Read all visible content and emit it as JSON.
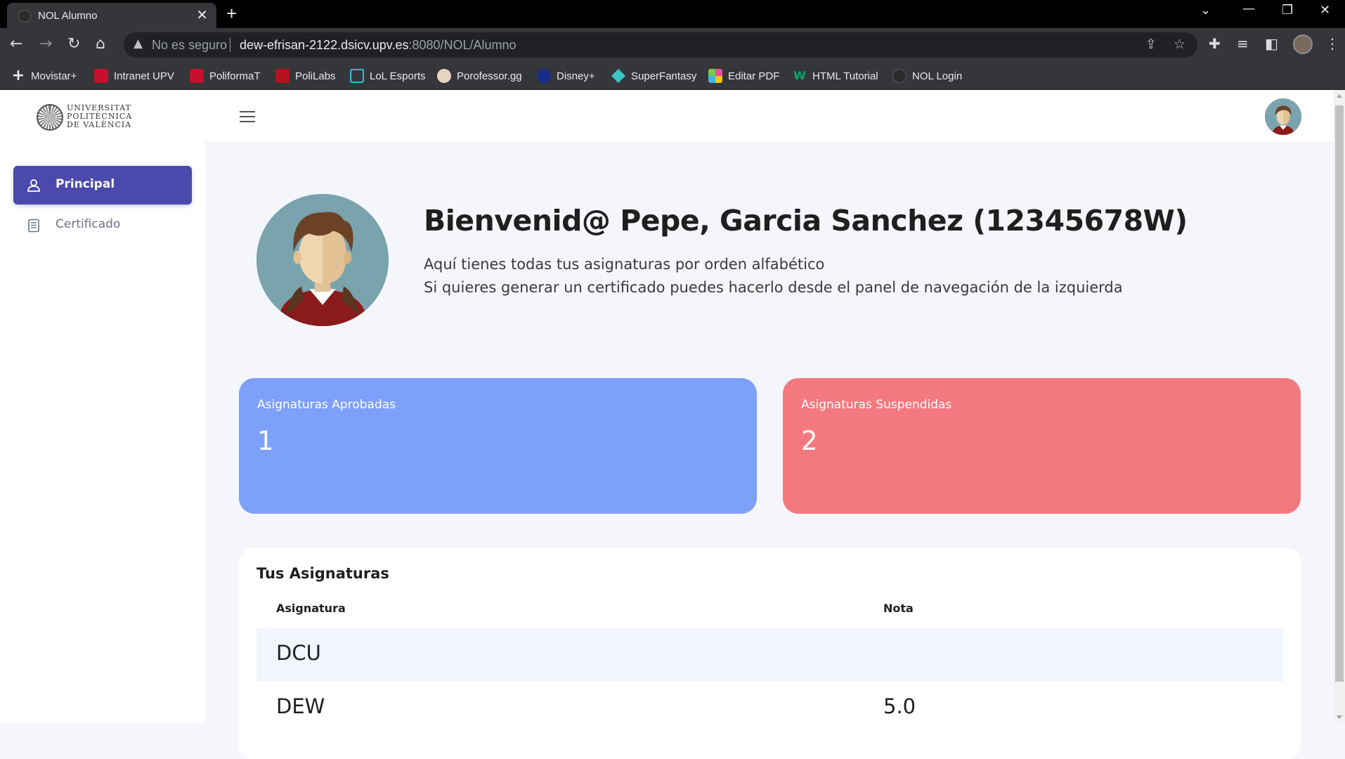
{
  "browser": {
    "tab_title": "NOL Alumno",
    "tab_close": "✕",
    "new_tab": "+",
    "insecure_label": "No es seguro",
    "url_host": "dew-efrisan-2122.dsicv.upv.es",
    "url_path": ":8080/NOL/Alumno",
    "bookmarks": [
      {
        "label": "Movistar+",
        "icon": "plus-icon",
        "color": "#111111"
      },
      {
        "label": "Intranet UPV",
        "icon": "upv-icon",
        "color": "#c8102e"
      },
      {
        "label": "PoliformaT",
        "icon": "upv-icon",
        "color": "#c8102e"
      },
      {
        "label": "PoliLabs",
        "icon": "lab-icon",
        "color": "#b3121e"
      },
      {
        "label": "LoL Esports",
        "icon": "lol-icon",
        "color": "#25c4e0"
      },
      {
        "label": "Porofessor.gg",
        "icon": "poro-icon",
        "color": "#e8d3c2"
      },
      {
        "label": "Disney+",
        "icon": "disney-icon",
        "color": "#1a2b8c"
      },
      {
        "label": "SuperFantasy",
        "icon": "gem-icon",
        "color": "#39c6c4"
      },
      {
        "label": "Editar PDF",
        "icon": "pdf-icon",
        "color": "#e84f9c"
      },
      {
        "label": "HTML Tutorial",
        "icon": "w3-icon",
        "color": "#04aa6d"
      },
      {
        "label": "NOL Login",
        "icon": "globe-icon",
        "color": "#2b2b2b"
      }
    ]
  },
  "header": {
    "logo_line1": "UNIVERSITAT",
    "logo_line2": "POLITÈCNICA",
    "logo_line3": "DE VALÈNCIA"
  },
  "sidebar": {
    "items": [
      {
        "label": "Principal",
        "icon": "user-icon",
        "active": true
      },
      {
        "label": "Certificado",
        "icon": "document-icon",
        "active": false
      }
    ]
  },
  "main": {
    "welcome": "Bienvenid@ Pepe, Garcia Sanchez (12345678W)",
    "line1": "Aquí tienes todas tus asignaturas por orden alfabético",
    "line2": "Si quieres generar un certificado puedes hacerlo desde el panel de navegación de la izquierda",
    "approved": {
      "title": "Asignaturas Aprobadas",
      "value": "1",
      "color": "#7da0fa"
    },
    "failed": {
      "title": "Asignaturas Suspendidas",
      "value": "2",
      "color": "#f3797e"
    },
    "table": {
      "title": "Tus Asignaturas",
      "columns": [
        "Asignatura",
        "Nota"
      ],
      "rows": [
        {
          "subject": "DCU",
          "grade": ""
        },
        {
          "subject": "DEW",
          "grade": "5.0"
        }
      ]
    }
  },
  "accent_color": "#4b49ac"
}
